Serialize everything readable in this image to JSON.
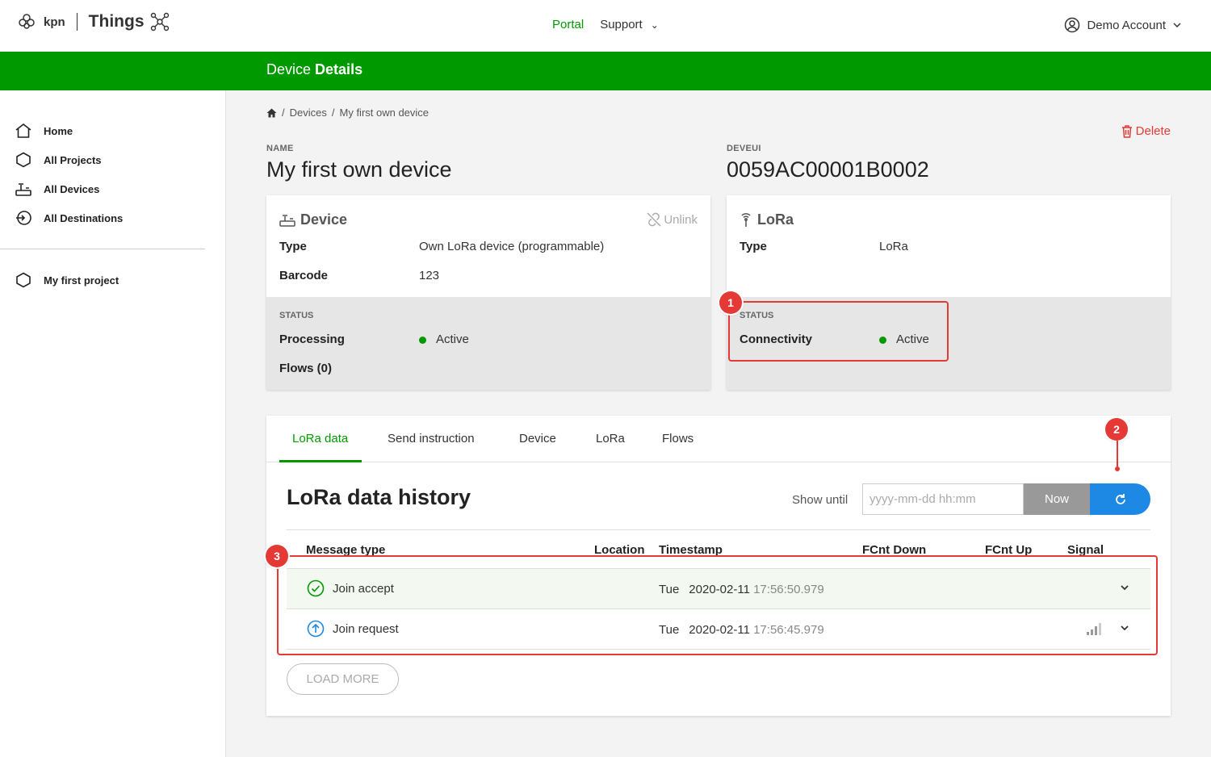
{
  "header": {
    "brand_kpn": "kpn",
    "brand_things": "Things",
    "nav_portal": "Portal",
    "nav_support": "Support",
    "account": "Demo Account"
  },
  "banner": {
    "title_light": "Device",
    "title_bold": "Details"
  },
  "sidebar": {
    "items": [
      {
        "label": "Home",
        "icon": "home-icon"
      },
      {
        "label": "All Projects",
        "icon": "hexagon-icon"
      },
      {
        "label": "All Devices",
        "icon": "router-icon"
      },
      {
        "label": "All Destinations",
        "icon": "destination-icon"
      }
    ],
    "project": "My first project"
  },
  "breadcrumb": {
    "devices": "Devices",
    "current": "My first own device"
  },
  "actions": {
    "delete": "Delete"
  },
  "device": {
    "name_label": "NAME",
    "name": "My first own device",
    "deveui_label": "DEVEUI",
    "deveui": "0059AC00001B0002"
  },
  "device_card": {
    "title": "Device",
    "unlink": "Unlink",
    "type_label": "Type",
    "type_value": "Own LoRa device (programmable)",
    "barcode_label": "Barcode",
    "barcode_value": "123",
    "status_title": "STATUS",
    "processing_label": "Processing",
    "processing_value": "Active",
    "flows_label": "Flows (0)"
  },
  "lora_card": {
    "title": "LoRa",
    "type_label": "Type",
    "type_value": "LoRa",
    "status_title": "STATUS",
    "connectivity_label": "Connectivity",
    "connectivity_value": "Active"
  },
  "annotations": {
    "a1": "1",
    "a2": "2",
    "a3": "3"
  },
  "tabs": [
    "LoRa data",
    "Send instruction",
    "Device",
    "LoRa",
    "Flows"
  ],
  "history": {
    "title": "LoRa data history",
    "show_until": "Show until",
    "date_placeholder": "yyyy-mm-dd hh:mm",
    "now": "Now",
    "columns": [
      "Message type",
      "Location",
      "Timestamp",
      "FCnt Down",
      "FCnt Up",
      "Signal"
    ],
    "rows": [
      {
        "type": "Join accept",
        "day": "Tue",
        "date": "2020-02-11",
        "time": "17:56:50.979",
        "icon": "check-circle-icon"
      },
      {
        "type": "Join request",
        "day": "Tue",
        "date": "2020-02-11",
        "time": "17:56:45.979",
        "icon": "arrow-up-circle-icon"
      }
    ],
    "load_more": "LOAD MORE"
  },
  "colors": {
    "brand_green": "#009900",
    "annotation_red": "#e53935",
    "refresh_blue": "#1e88e5"
  }
}
